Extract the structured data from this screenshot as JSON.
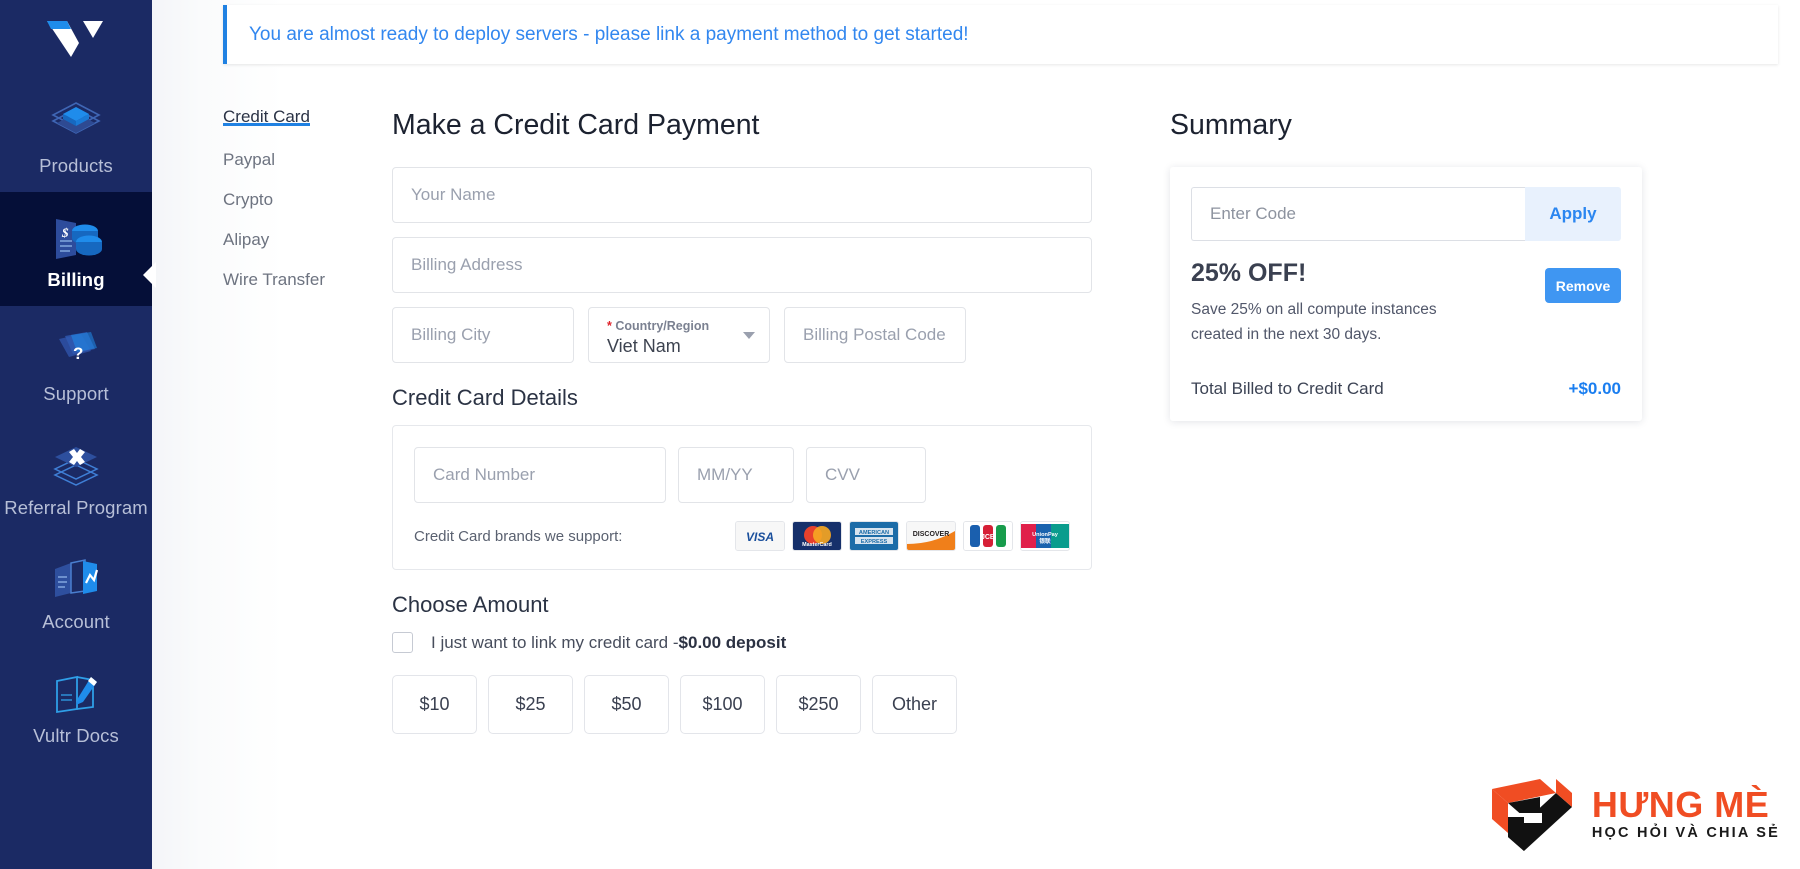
{
  "brand": {
    "logo_name": "vultr-logo",
    "accent": "#2081e2",
    "sidebar_bg": "#1b2a64",
    "sidebar_active_bg": "#050f38"
  },
  "sidebar": {
    "items": [
      {
        "label": "Products",
        "icon": "layers-cube-icon",
        "active": false
      },
      {
        "label": "Billing",
        "icon": "invoice-coins-icon",
        "active": true
      },
      {
        "label": "Support",
        "icon": "layers-question-icon",
        "active": false
      },
      {
        "label": "Referral Program",
        "icon": "layers-x-icon",
        "active": false
      },
      {
        "label": "Account",
        "icon": "account-chart-icon",
        "active": false
      },
      {
        "label": "Vultr Docs",
        "icon": "book-pencil-icon",
        "active": false
      }
    ],
    "collapse_icon": "collapse-left-arrow-icon"
  },
  "banner": {
    "text": "You are almost ready to deploy servers - please link a payment method to get started!",
    "accent": "#2081e2"
  },
  "payment_tabs": [
    {
      "label": "Credit Card",
      "active": true
    },
    {
      "label": "Paypal",
      "active": false
    },
    {
      "label": "Crypto",
      "active": false
    },
    {
      "label": "Alipay",
      "active": false
    },
    {
      "label": "Wire Transfer",
      "active": false
    }
  ],
  "form": {
    "title": "Make a Credit Card Payment",
    "name_placeholder": "Your Name",
    "name_value": "",
    "address_placeholder": "Billing Address",
    "address_value": "",
    "city_placeholder": "Billing City",
    "city_value": "",
    "country_required_mark": "*",
    "country_label": "Country/Region",
    "country_value": "Viet Nam",
    "country_caret_icon": "chevron-down-icon",
    "postal_placeholder": "Billing Postal Code",
    "postal_value": ""
  },
  "credit_card": {
    "section_title": "Credit Card Details",
    "card_number_placeholder": "Card Number",
    "card_number_value": "",
    "expiry_placeholder": "MM/YY",
    "expiry_value": "",
    "cvv_placeholder": "CVV",
    "cvv_value": "",
    "brands_label": "Credit Card brands we support:",
    "brands": [
      {
        "name": "visa",
        "text": "VISA"
      },
      {
        "name": "mastercard",
        "text": "MasterCard"
      },
      {
        "name": "american-express",
        "text": "AMERICAN EXPRESS"
      },
      {
        "name": "discover",
        "text": "DISCOVER"
      },
      {
        "name": "jcb",
        "text": "JCB"
      },
      {
        "name": "unionpay",
        "text": "UnionPay"
      }
    ]
  },
  "choose_amount": {
    "section_title": "Choose Amount",
    "checkbox_checked": false,
    "checkbox_text": "I just want to link my credit card -",
    "checkbox_bold": "$0.00 deposit",
    "amounts": [
      "$10",
      "$25",
      "$50",
      "$100",
      "$250",
      "Other"
    ]
  },
  "summary": {
    "title": "Summary",
    "code_placeholder": "Enter Code",
    "code_value": "",
    "apply_label": "Apply",
    "promo_title": "25% OFF!",
    "promo_desc": "Save 25% on all compute instances created in the next 30 days.",
    "remove_label": "Remove",
    "total_label": "Total Billed to Credit Card",
    "total_value": "+$0.00"
  },
  "watermark": {
    "title": "HƯNG MÈ",
    "subtitle": "HỌC HỎI VÀ CHIA SẺ"
  }
}
